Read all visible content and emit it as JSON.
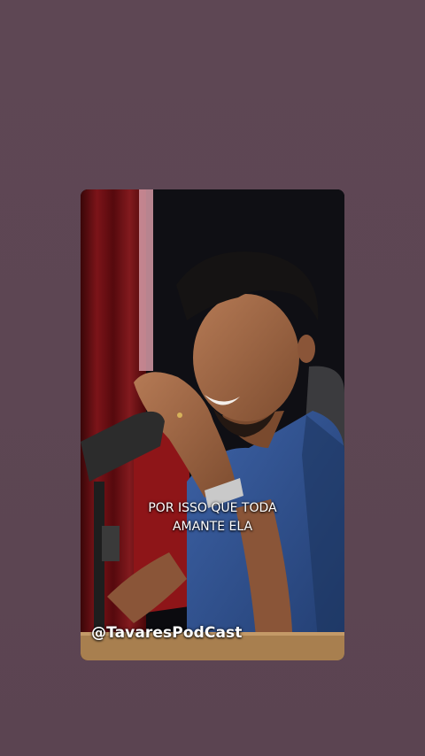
{
  "video": {
    "caption_lines": [
      "POR ISSO QUE TODA",
      "AMANTE ELA"
    ],
    "watermark": "@TavaresPodCast"
  },
  "colors": {
    "background": "#5d4653",
    "caption_text": "#ffffff",
    "curtain": "#7a1418",
    "shirt": "#2e4f8c"
  }
}
